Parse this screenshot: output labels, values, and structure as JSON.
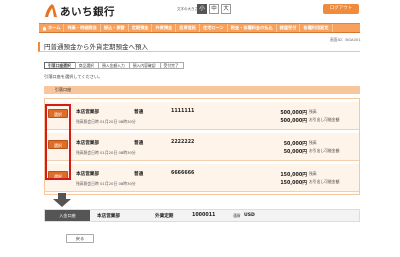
{
  "header": {
    "bank_name": "あいち銀行",
    "fontsize_label": "文字の大きさ",
    "fontsize_small": "小",
    "fontsize_mid": "中",
    "fontsize_large": "大",
    "logout_label": "ログアウト",
    "brand_color": "#e8823a"
  },
  "nav": {
    "items": [
      "ホーム",
      "残高・明細照会",
      "振込・振替",
      "定期預金",
      "外貨預金",
      "投資信託",
      "住宅ローン",
      "税金・各種料金の払込",
      "諸届受付",
      "各種利用設定"
    ]
  },
  "page": {
    "screen_id": "画面ID：BGA001",
    "title": "円普通預金から外貨定期預金へ預入",
    "steps": [
      "引落口座選択",
      "商品選択",
      "預入金額入力",
      "預入内容確認",
      "受付完了"
    ],
    "instruction": "引落口座を選択してください。",
    "from_label": "引落口座",
    "select_label": "選択",
    "balance_label": "残高",
    "withdrawable_label": "お引出し可能金額"
  },
  "accounts": [
    {
      "branch": "本店営業部",
      "type": "普通",
      "number": "1111111",
      "balance": "500,000円",
      "withdrawable": "500,000円",
      "balance_time": "残高照会日時 01月20日 08時30分"
    },
    {
      "branch": "本店営業部",
      "type": "普通",
      "number": "2222222",
      "balance": "50,000円",
      "withdrawable": "50,000円",
      "balance_time": "残高照会日時 01月20日 08時30分"
    },
    {
      "branch": "本店営業部",
      "type": "普通",
      "number": "6666666",
      "balance": "150,000円",
      "withdrawable": "150,000円",
      "balance_time": "残高照会日時 01月20日 08時30分"
    }
  ],
  "deposit_to": {
    "label": "入金口座",
    "branch": "本店営業部",
    "type": "外貨定期",
    "number": "1000011",
    "currency_label": "通貨",
    "currency": "USD"
  },
  "footer": {
    "back_label": "戻る"
  }
}
